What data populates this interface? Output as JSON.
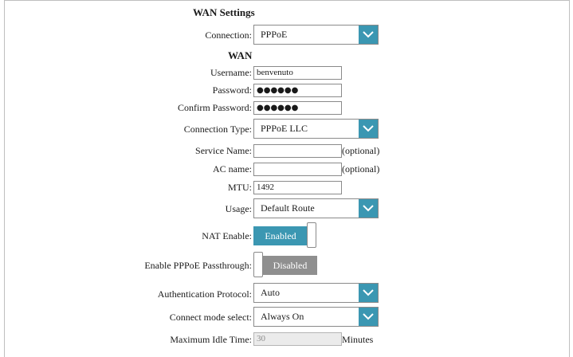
{
  "section_title": "WAN Settings",
  "connection": {
    "label": "Connection:",
    "value": "PPPoE"
  },
  "wan_title": "WAN",
  "username": {
    "label": "Username:",
    "value": "benvenuto"
  },
  "password": {
    "label": "Password:",
    "value": "●●●●●●"
  },
  "confirm_password": {
    "label": "Confirm Password:",
    "value": "●●●●●●"
  },
  "connection_type": {
    "label": "Connection Type:",
    "value": "PPPoE LLC"
  },
  "service_name": {
    "label": "Service Name:",
    "value": "",
    "note": "(optional)"
  },
  "ac_name": {
    "label": "AC name:",
    "value": "",
    "note": "(optional)"
  },
  "mtu": {
    "label": "MTU:",
    "value": "1492"
  },
  "usage": {
    "label": "Usage:",
    "value": "Default Route"
  },
  "nat_enable": {
    "label": "NAT Enable:",
    "state": "Enabled"
  },
  "pppoe_passthrough": {
    "label": "Enable PPPoE Passthrough:",
    "state": "Disabled"
  },
  "auth_protocol": {
    "label": "Authentication Protocol:",
    "value": "Auto"
  },
  "connect_mode": {
    "label": "Connect mode select:",
    "value": "Always On"
  },
  "max_idle_time": {
    "label": "Maximum Idle Time:",
    "value": "30",
    "unit": "Minutes"
  },
  "colors": {
    "accent": "#3b97b2",
    "disabled_toggle": "#8f8f8f",
    "border": "#8a8a8a"
  },
  "icons": {
    "dropdown": "chevron-down-icon"
  }
}
